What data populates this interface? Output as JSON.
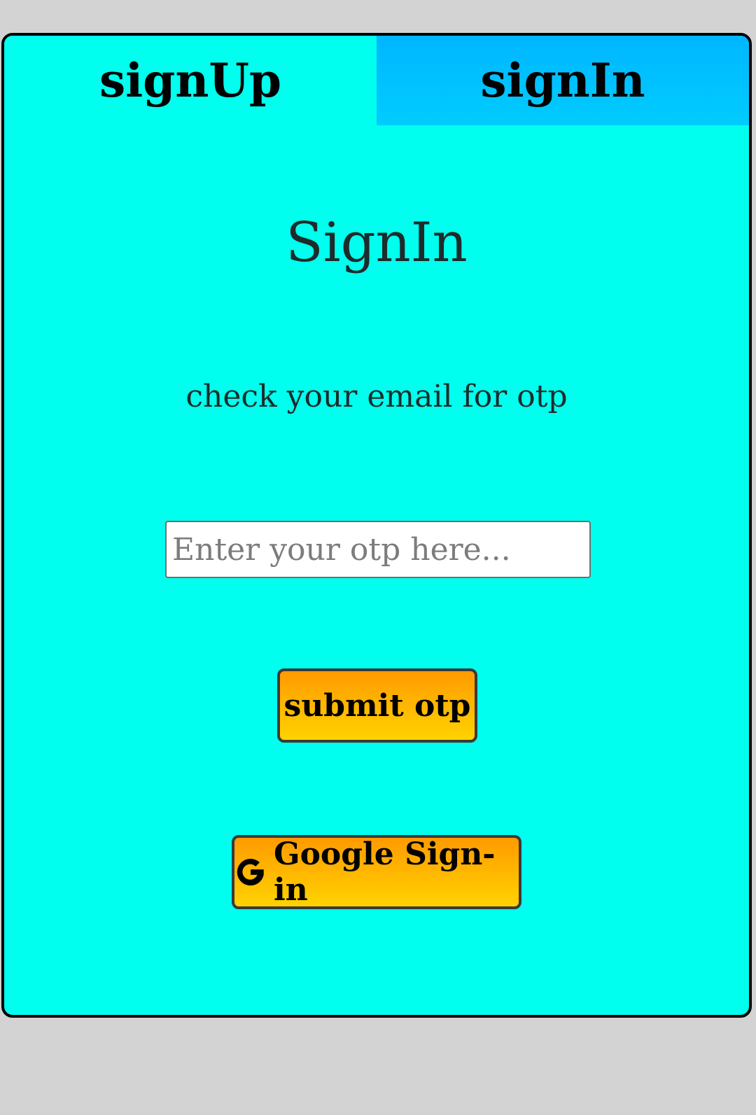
{
  "tabs": {
    "signup_label": "signUp",
    "signin_label": "signIn"
  },
  "title": "SignIn",
  "subtitle": "check your email for otp",
  "otp_input": {
    "placeholder": "Enter your otp here...",
    "value": ""
  },
  "buttons": {
    "submit_label": "submit otp",
    "google_label": "Google Sign-in"
  },
  "icons": {
    "google": "google-g-icon"
  },
  "colors": {
    "page_bg": "#d3d3d3",
    "card_bg": "#00ffee",
    "active_tab_bg": "#00c2ff",
    "button_gradient_top": "#ff9a00",
    "button_gradient_bottom": "#ffd300"
  }
}
